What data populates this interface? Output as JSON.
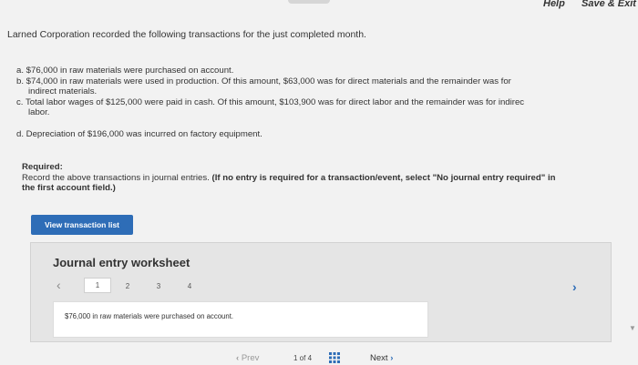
{
  "topbar": {
    "help_label": "Help",
    "save_exit_label": "Save & Exit"
  },
  "intro": "Larned Corporation recorded the following transactions for the just completed month.",
  "transactions": {
    "a": "a. $76,000 in raw materials were purchased on account.",
    "b_line1": "b. $74,000 in raw materials were used in production. Of this amount, $63,000 was for direct materials and the remainder was for",
    "b_line2": "indirect materials.",
    "c_line1": "c. Total labor wages of $125,000 were paid in cash. Of this amount, $103,900 was for direct labor and the remainder was for indirec",
    "c_line2": "labor.",
    "d": "d. Depreciation of $196,000 was incurred on factory equipment."
  },
  "required": {
    "label": "Required:",
    "text": "Record the above transactions in journal entries.",
    "note_line1": "(If no entry is required for a transaction/event, select \"No journal entry required\" in",
    "note_line2": "the first account field.)"
  },
  "view_transaction_button": "View transaction list",
  "worksheet": {
    "title": "Journal entry worksheet",
    "tabs": [
      "1",
      "2",
      "3",
      "4"
    ],
    "active_tab": "1",
    "description": "$76,000 in raw materials were purchased on account."
  },
  "bottom_nav": {
    "prev_label": "Prev",
    "page_count": "1 of 4",
    "next_label": "Next"
  },
  "colors": {
    "accent_blue": "#2e6db7",
    "background": "#f2f2f2"
  },
  "icons": {
    "prev": "chevron-left-icon",
    "next": "chevron-right-icon",
    "grid": "grid-icon"
  }
}
